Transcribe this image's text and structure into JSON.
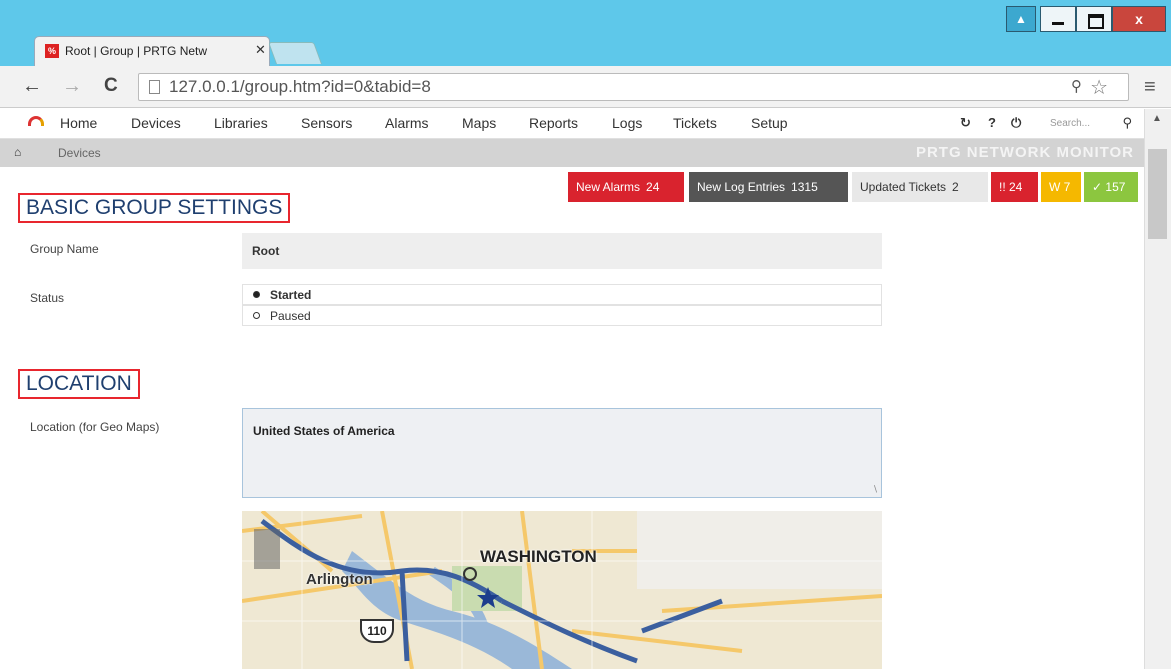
{
  "browser": {
    "tab_title": "Root | Group | PRTG Netw",
    "tab_close": "✕",
    "favicon_text": "%",
    "url": "127.0.0.1/group.htm?id=0&tabid=8",
    "window_buttons": {
      "user": "▲",
      "close": "x"
    }
  },
  "nav": {
    "items": [
      "Home",
      "Devices",
      "Libraries",
      "Sensors",
      "Alarms",
      "Maps",
      "Reports",
      "Logs",
      "Tickets",
      "Setup"
    ],
    "search_placeholder": "Search..."
  },
  "breadcrumb": {
    "current": "Devices",
    "brand": "PRTG NETWORK MONITOR"
  },
  "badges": {
    "alarms": {
      "label": "New Alarms",
      "count": "24"
    },
    "log": {
      "label": "New Log Entries",
      "count": "1315"
    },
    "tickets": {
      "label": "Updated Tickets",
      "count": "2"
    },
    "errors": "!! 24",
    "warnings": "W 7",
    "ok": "✓ 157",
    "colors": {
      "error": "#d9232e",
      "warning": "#f5b800",
      "ok": "#8cc63f",
      "log": "#555555"
    }
  },
  "basic": {
    "title": "BASIC GROUP SETTINGS",
    "group_name_label": "Group Name",
    "group_name_value": "Root",
    "status_label": "Status",
    "status_options": [
      "Started",
      "Paused"
    ],
    "status_selected": "Started"
  },
  "location": {
    "title": "LOCATION",
    "label": "Location (for Geo Maps)",
    "value": "United States of America",
    "map_labels": {
      "city": "WASHINGTON",
      "area": "Arlington",
      "route": "110"
    }
  }
}
